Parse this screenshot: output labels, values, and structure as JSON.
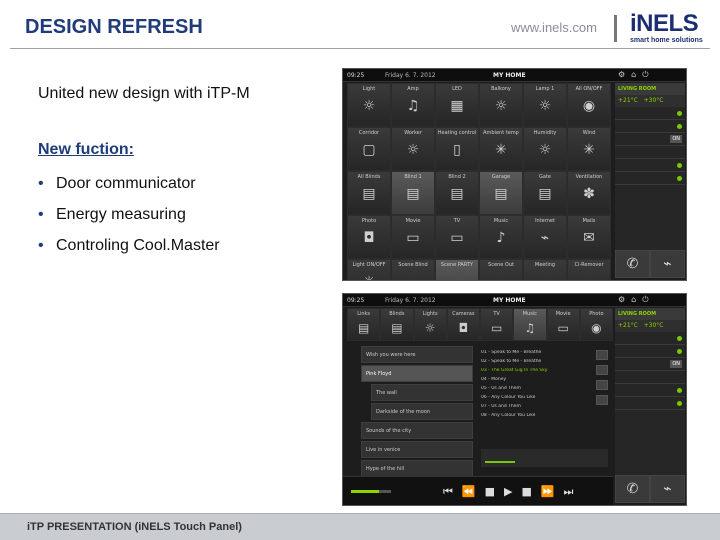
{
  "header": {
    "title": "DESIGN REFRESH",
    "site_url": "www.inels.com",
    "logo_word": "iNELS",
    "logo_tagline": "smart home solutions"
  },
  "content": {
    "intro": "United new design with iTP-M",
    "new_function_heading": "New fuction:",
    "bullets": [
      "Door communicator",
      "Energy measuring",
      "Controling Cool.Master"
    ]
  },
  "panel_top": {
    "time": "09:25",
    "date": "Friday 6. 7. 2012",
    "title": "MY HOME",
    "room": "LIVING ROOM",
    "temp_now": "+21°C",
    "temp_set": "+30°C",
    "on_label": "ON",
    "tiles": [
      [
        "Light",
        "Amp",
        "LED",
        "Balkony",
        "Lamp 1",
        "All ON/OFF"
      ],
      [
        "Corridor",
        "Worker",
        "Heating control",
        "Ambient temp",
        "Humidity",
        "Wind"
      ],
      [
        "All Blinds",
        "Blind 1",
        "Blind 2",
        "Garage",
        "Gate",
        "Ventilation"
      ],
      [
        "Photo",
        "Movie",
        "TV",
        "Music",
        "Internet",
        "Mails"
      ],
      [
        "Light ON/OFF",
        "Scene Blind",
        "Scene PARTY",
        "Scene Out",
        "Meeting",
        "Cl-Remover"
      ]
    ]
  },
  "panel_bottom": {
    "time": "09:25",
    "date": "Friday 6. 7. 2012",
    "title": "MY HOME",
    "room": "LIVING ROOM",
    "temp_now": "+21°C",
    "temp_set": "+30°C",
    "on_label": "ON",
    "tabs": [
      "Links",
      "Blinds",
      "Lights",
      "Cameras",
      "TV",
      "Music",
      "Movie",
      "Photo"
    ],
    "folders": [
      "Wish you were here",
      "Pink Floyd",
      "The wall",
      "Darkside of the moon",
      "Sounds of the city",
      "Live in venice",
      "Hype of the hill"
    ],
    "tracks": [
      "01 - Speak to Me - Breathe",
      "02 - Speak to Me - Breathe",
      "03 - The Great Gig In The Sky",
      "04 - Money",
      "05 - Us and Them",
      "06 - Any Colour You Like",
      "07 - Us and Them",
      "08 - Any Colour You Like"
    ]
  },
  "footer": {
    "text": "iTP PRESENTATION (iNELS Touch Panel)"
  }
}
